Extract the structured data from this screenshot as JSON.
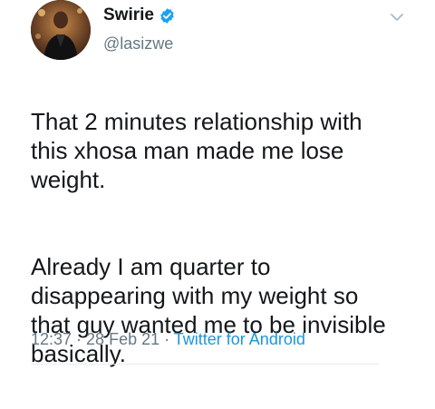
{
  "author": {
    "display_name": "Swirie",
    "handle": "@lasizwe",
    "verified": true
  },
  "tweet": {
    "paragraphs": [
      "That 2 minutes relationship with\nthis xhosa man made me lose\nweight.",
      "Already I am quarter to\ndisappearing with my weight so\nthat guy wanted me to be invisible\nbasically."
    ]
  },
  "meta": {
    "time": "12:37",
    "separator_1": " · ",
    "date": "28 Feb 21",
    "separator_2": " · ",
    "source": "Twitter for Android"
  },
  "colors": {
    "text_primary": "#14171a",
    "text_secondary": "#657786",
    "link": "#1b95e0",
    "verified": "#1da1f2",
    "divider": "#e6ecf0"
  },
  "icons": {
    "verified": "verified-badge-icon",
    "menu": "chevron-down-icon"
  }
}
